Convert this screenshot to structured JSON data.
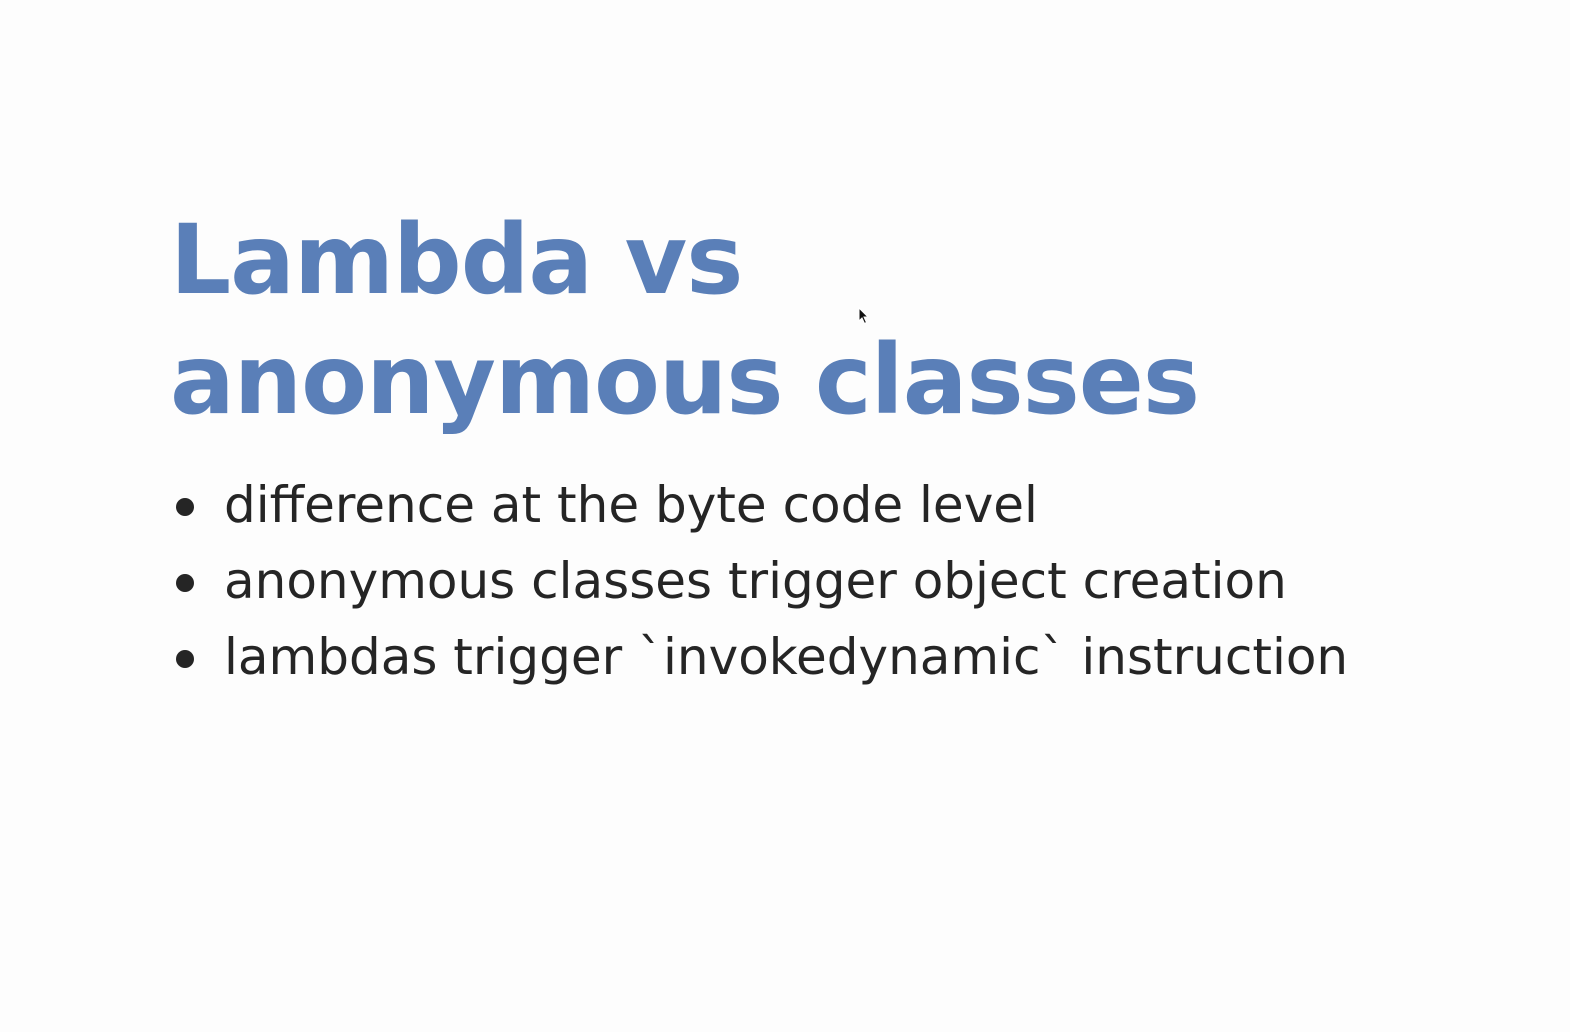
{
  "slide": {
    "title": "Lambda vs anonymous classes",
    "bullets": [
      "difference at the byte code level",
      "anonymous classes trigger object creation",
      "lambdas trigger `invokedynamic` instruction"
    ]
  },
  "colors": {
    "background": "#fdfdfd",
    "title": "#5a7fb8",
    "body_text": "#252525"
  },
  "icons": {
    "cursor": "mouse-pointer-icon"
  }
}
